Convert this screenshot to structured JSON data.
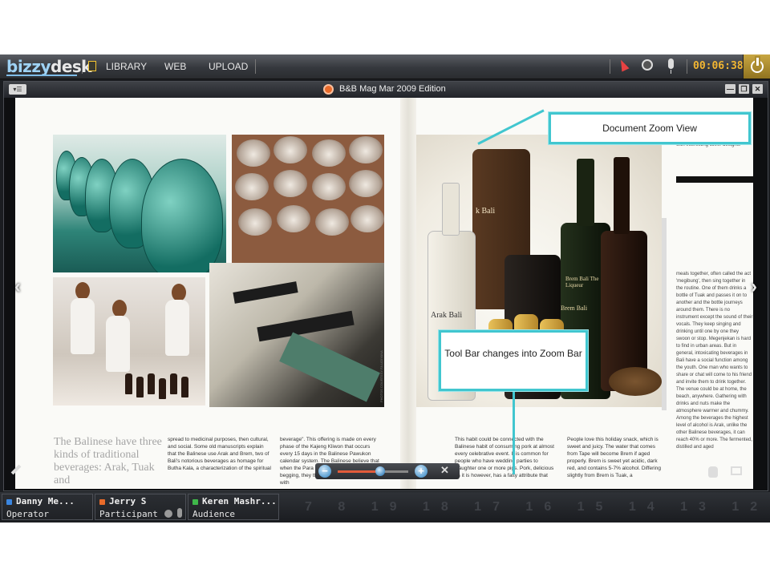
{
  "app": {
    "logo_main": "bizzy",
    "logo_accent": "desk",
    "nav": [
      "LIBRARY",
      "WEB",
      "UPLOAD"
    ],
    "timer": "00:06:38",
    "icons": [
      "document-icon",
      "pointer-icon",
      "webcam-icon",
      "microphone-icon",
      "power-icon"
    ]
  },
  "document": {
    "title": "B&B Mag Mar 2009 Edition",
    "menu_glyph": "▾☰",
    "window_buttons": [
      "—",
      "❐",
      "✕"
    ],
    "page_heading": "The Balinese have three kinds of traditional beverages: Arak, Tuak and",
    "col1": "spread to medicinal purposes, then cultural, and social. Some old manuscripts explain that the Balinese use Arak and Brem, two of Bali's notorious beverages as homage for Butha Kala, a characterization of the spiritual",
    "col2": "beverage\". This offering is made on every phase of the Kajeng Kliwon that occurs every 15 days in the Balinese Pawukon calendar system. The Balinese believe that when the Para Butha Kala have been begging, they then go home to their place with",
    "col3": "This habit could be connected with the Balinese habit of consuming pork at almost every celebrative event. It is common for people who have wedding parties to slaughter one or more pigs. Pork, delicious as it is however, has a fatty attribute that",
    "col4": "People love this holiday snack, which is sweet and juicy. The water that comes from Tape will become Brem if aged properly. Brem is sweet yet acidic, dark red, and contains 5-7% alcohol. Differing slightly from Brem is Tuak, a",
    "right_col_top": "the beverages and package them with interesting cover designs.",
    "right_col_body": "meals together, often called the act 'megibung', then sing together in the routine. One of them drinks a bottle of Tuak and passes it on to another and the bottle journeys around them. There is no instrument except the sound of their vocals. They keep singing and drinking until one by one they swoon or stop. Megenjekan is hard to find in urban areas. But in general, intoxicating beverages in Bali have a social function among the youth. One man who wants to share or chat will come to his friend and invite them to drink together. The venue could be at home, the beach, anywhere. Gathering with drinks and nuts make the atmosphere warmer and chummy. Among the beverages the highest level of alcohol is Arak, unlike the other Balinese beverages, it can reach 40% or more. The fermented, distilled and aged",
    "photo_credit": "PHOTOS COURTESY FA LIDIYANA",
    "label_arak": "Arak Bali",
    "label_brem": "Brem Bali",
    "label_liqueur": "Brem Bali The Liqueur",
    "label_box": "k Bali"
  },
  "zoombar": {
    "value": 0.6,
    "minus": "−",
    "plus": "+",
    "close": "✕"
  },
  "callouts": {
    "zoom_view": "Document Zoom View",
    "toolbar": "Tool Bar changes into Zoom Bar",
    "color": "#41c6cf"
  },
  "participants": [
    {
      "name": "Danny Me...",
      "role": "Operator",
      "color": "#3a86e0"
    },
    {
      "name": "Jerry S",
      "role": "Participant",
      "color": "#e86b2a"
    },
    {
      "name": "Keren Mashr...",
      "role": "Audience",
      "color": "#3fb84a"
    }
  ],
  "clock_digits": "7 8 19 18 17 16 15 14 13 12"
}
